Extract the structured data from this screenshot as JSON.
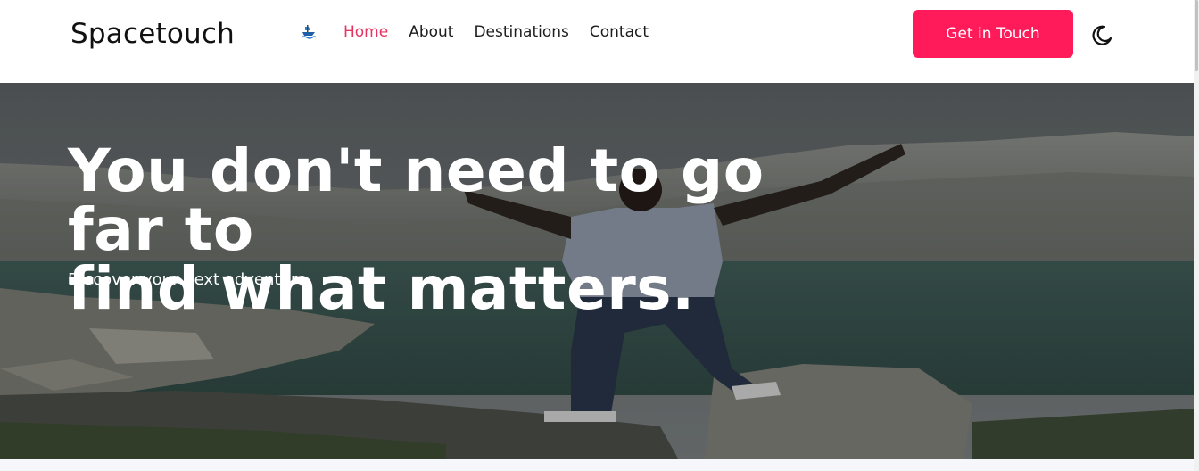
{
  "header": {
    "brand": "Spacetouch",
    "nav": [
      {
        "label": "Home",
        "active": true
      },
      {
        "label": "About",
        "active": false
      },
      {
        "label": "Destinations",
        "active": false
      },
      {
        "label": "Contact",
        "active": false
      }
    ],
    "cta_label": "Get in Touch",
    "theme_icon": "moon-icon",
    "logo_icon": "boat-icon"
  },
  "hero": {
    "title_line1": "You don't need to go far to",
    "title_line2": "find what matters.",
    "subtitle": "Discover your next adventure"
  },
  "colors": {
    "accent": "#ff1a5a",
    "active_link": "#e63462",
    "text_dark": "#1c1c1c",
    "hero_text": "#ffffff"
  }
}
